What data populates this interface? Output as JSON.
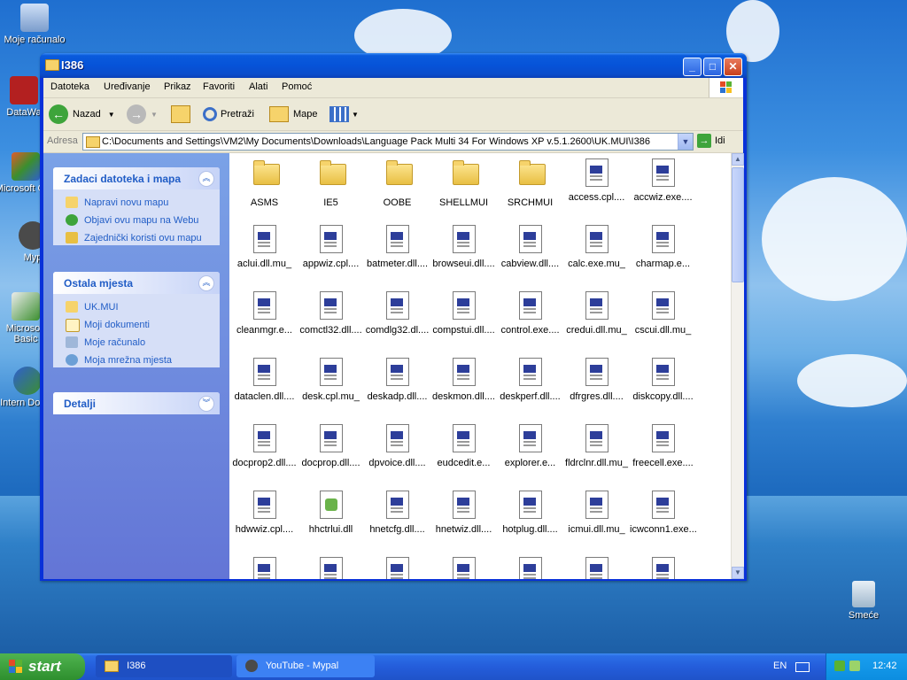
{
  "desktop": {
    "icons": [
      {
        "label": "Moje računalo"
      },
      {
        "label": "DataWa"
      },
      {
        "label": "Microsoft C++"
      },
      {
        "label": "Myp"
      },
      {
        "label": "Microsoft Basic"
      },
      {
        "label": "Intern Downl"
      }
    ],
    "recycle_label": "Smeće"
  },
  "window": {
    "title": "I386",
    "min": "_",
    "max": "□",
    "close": "✕",
    "menu": [
      "Datoteka",
      "Uređivanje",
      "Prikaz",
      "Favoriti",
      "Alati",
      "Pomoć"
    ],
    "toolbar": {
      "back": "Nazad",
      "search": "Pretraži",
      "folders": "Mape"
    },
    "address": {
      "label": "Adresa",
      "path": "C:\\Documents and Settings\\VM2\\My Documents\\Downloads\\Language Pack Multi 34 For Windows XP v.5.1.2600\\UK.MUI\\I386",
      "go": "Idi"
    }
  },
  "sidebar": {
    "tasks": {
      "title": "Zadaci datoteka i mapa",
      "items": [
        "Napravi novu mapu",
        "Objavi ovu mapu na Webu",
        "Zajednički koristi ovu mapu"
      ]
    },
    "places": {
      "title": "Ostala mjesta",
      "items": [
        "UK.MUI",
        "Moji dokumenti",
        "Moje računalo",
        "Moja mrežna mjesta"
      ]
    },
    "details": {
      "title": "Detalji"
    }
  },
  "files": [
    {
      "name": "ASMS",
      "type": "folder"
    },
    {
      "name": "IE5",
      "type": "folder"
    },
    {
      "name": "OOBE",
      "type": "folder"
    },
    {
      "name": "SHELLMUI",
      "type": "folder"
    },
    {
      "name": "SRCHMUI",
      "type": "folder"
    },
    {
      "name": "access.cpl....",
      "type": "file"
    },
    {
      "name": "accwiz.exe....",
      "type": "file"
    },
    {
      "name": "aclui.dll.mu_",
      "type": "file"
    },
    {
      "name": "appwiz.cpl....",
      "type": "file"
    },
    {
      "name": "batmeter.dll....",
      "type": "file"
    },
    {
      "name": "browseui.dll....",
      "type": "file"
    },
    {
      "name": "cabview.dll....",
      "type": "file"
    },
    {
      "name": "calc.exe.mu_",
      "type": "file"
    },
    {
      "name": "charmap.e...",
      "type": "file"
    },
    {
      "name": "cleanmgr.e...",
      "type": "file"
    },
    {
      "name": "comctl32.dll....",
      "type": "file"
    },
    {
      "name": "comdlg32.dl....",
      "type": "file"
    },
    {
      "name": "compstui.dll....",
      "type": "file"
    },
    {
      "name": "control.exe....",
      "type": "file"
    },
    {
      "name": "credui.dll.mu_",
      "type": "file"
    },
    {
      "name": "cscui.dll.mu_",
      "type": "file"
    },
    {
      "name": "dataclen.dll....",
      "type": "file"
    },
    {
      "name": "desk.cpl.mu_",
      "type": "file"
    },
    {
      "name": "deskadp.dll....",
      "type": "file"
    },
    {
      "name": "deskmon.dll....",
      "type": "file"
    },
    {
      "name": "deskperf.dll....",
      "type": "file"
    },
    {
      "name": "dfrgres.dll....",
      "type": "file"
    },
    {
      "name": "diskcopy.dll....",
      "type": "file"
    },
    {
      "name": "docprop2.dll....",
      "type": "file"
    },
    {
      "name": "docprop.dll....",
      "type": "file"
    },
    {
      "name": "dpvoice.dll....",
      "type": "file"
    },
    {
      "name": "eudcedit.e...",
      "type": "file"
    },
    {
      "name": "explorer.e...",
      "type": "file"
    },
    {
      "name": "fldrclnr.dll.mu_",
      "type": "file"
    },
    {
      "name": "freecell.exe....",
      "type": "file"
    },
    {
      "name": "hdwwiz.cpl....",
      "type": "file"
    },
    {
      "name": "hhctrlui.dll",
      "type": "app"
    },
    {
      "name": "hnetcfg.dll....",
      "type": "file"
    },
    {
      "name": "hnetwiz.dll....",
      "type": "file"
    },
    {
      "name": "hotplug.dll....",
      "type": "file"
    },
    {
      "name": "icmui.dll.mu_",
      "type": "file"
    },
    {
      "name": "icwconn1.exe....",
      "type": "file"
    },
    {
      "name": "",
      "type": "file"
    },
    {
      "name": "",
      "type": "file"
    },
    {
      "name": "",
      "type": "file"
    },
    {
      "name": "",
      "type": "file"
    },
    {
      "name": "",
      "type": "file"
    },
    {
      "name": "",
      "type": "file"
    },
    {
      "name": "",
      "type": "file"
    }
  ],
  "taskbar": {
    "start": "start",
    "tasks": [
      {
        "label": "I386"
      },
      {
        "label": "YouTube - Mypal"
      }
    ],
    "lang": "EN",
    "clock": "12:42"
  }
}
